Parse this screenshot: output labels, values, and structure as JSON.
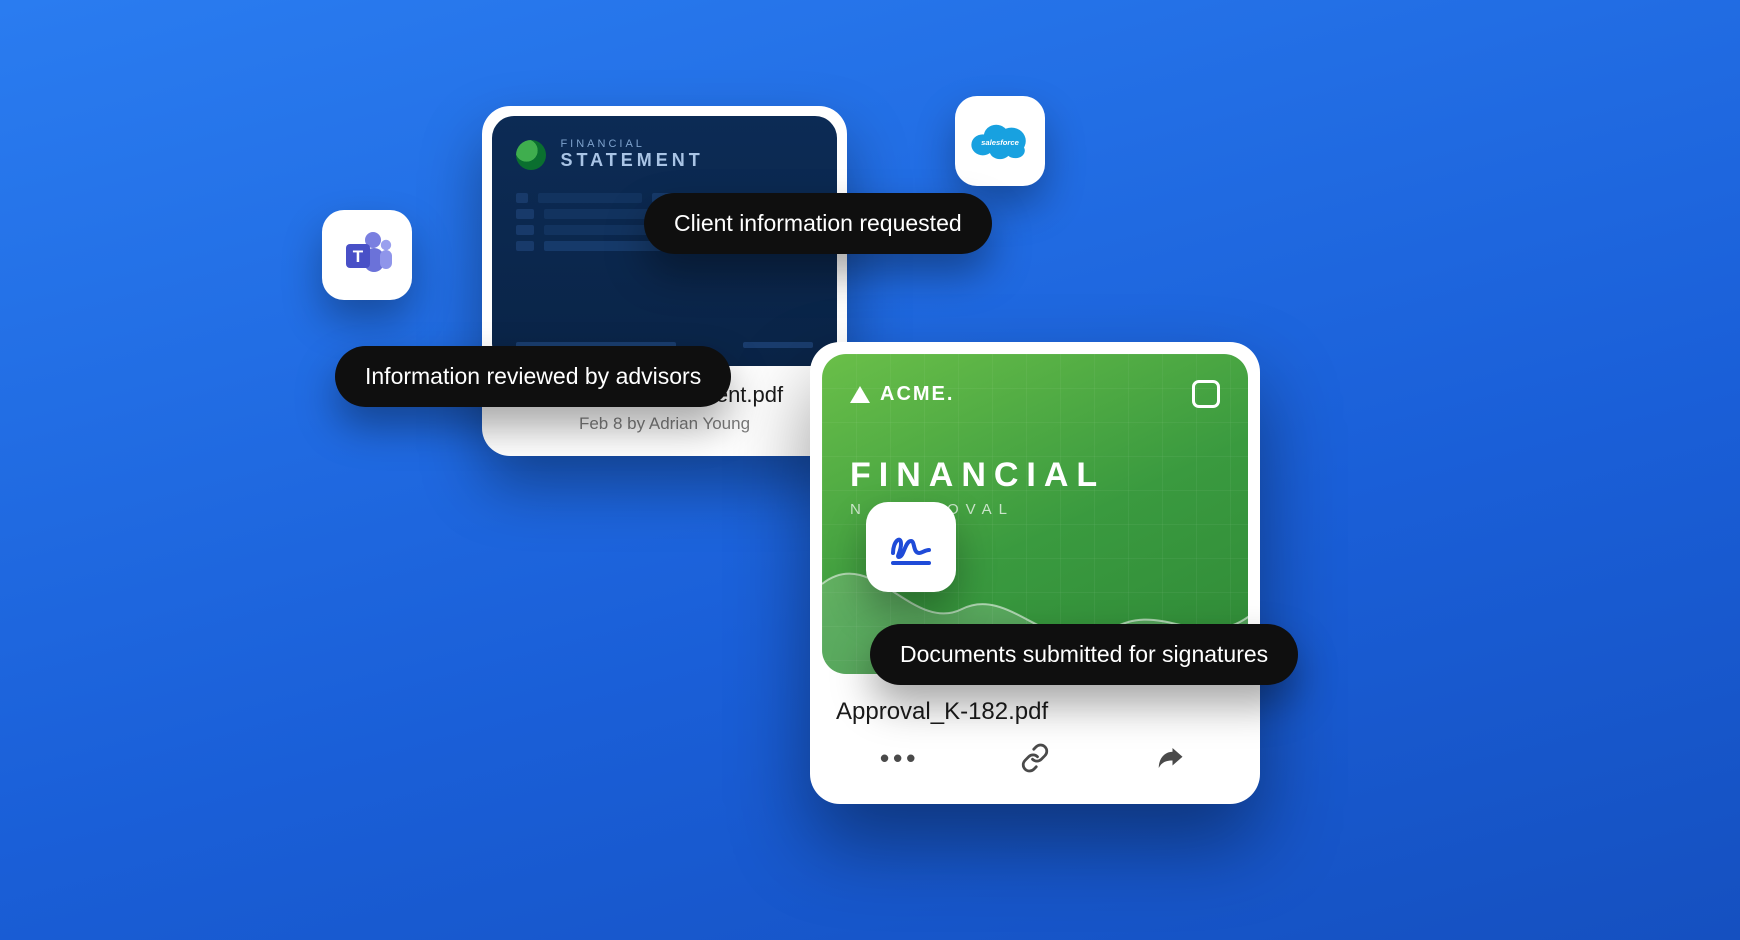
{
  "card1": {
    "eyebrow": "FINANCIAL",
    "word": "STATEMENT",
    "filename": "Financial_Statement.pdf",
    "meta": "Feb 8 by Adrian Young"
  },
  "card2": {
    "brand": "ACME.",
    "word": "FINANCIAL",
    "sub_suffix": "N APPROVAL",
    "filename": "Approval_K-182.pdf"
  },
  "pills": {
    "p1": "Client information requested",
    "p2": "Information reviewed by advisors",
    "p3": "Documents submitted for signatures"
  },
  "badges": {
    "sf_label": "salesforce"
  }
}
